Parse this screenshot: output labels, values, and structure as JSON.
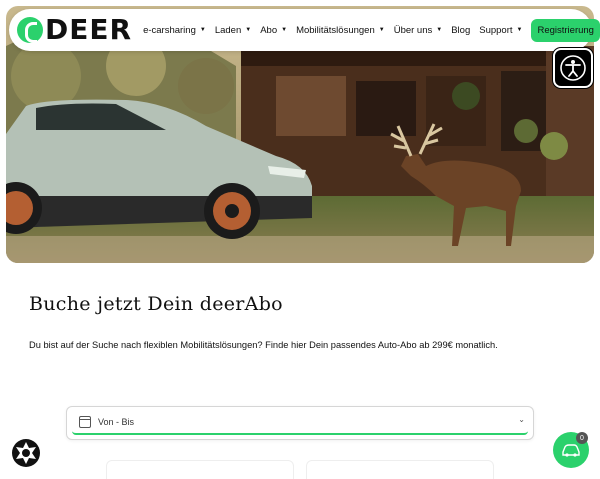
{
  "brand": {
    "name": "DEER",
    "accent": "#2bd16c"
  },
  "nav": {
    "items": [
      {
        "label": "e-carsharing",
        "dropdown": true
      },
      {
        "label": "Laden",
        "dropdown": true
      },
      {
        "label": "Abo",
        "dropdown": true
      },
      {
        "label": "Mobilitätslösungen",
        "dropdown": true
      },
      {
        "label": "Über uns",
        "dropdown": true
      },
      {
        "label": "Blog",
        "dropdown": false
      },
      {
        "label": "Support",
        "dropdown": true
      }
    ],
    "cta_label": "Registrierung"
  },
  "accessibility": {
    "icon": "accessibility-icon"
  },
  "content": {
    "headline": "Buche jetzt Dein deerAbo",
    "lead": "Du bist auf der Suche nach flexiblen Mobilitätslösungen? Finde hier Dein passendes Auto-Abo ab 299€ monatlich."
  },
  "date_picker": {
    "value": "Von - Bis",
    "icon": "calendar-icon"
  },
  "chat_widget": {
    "badge_count": "0"
  }
}
